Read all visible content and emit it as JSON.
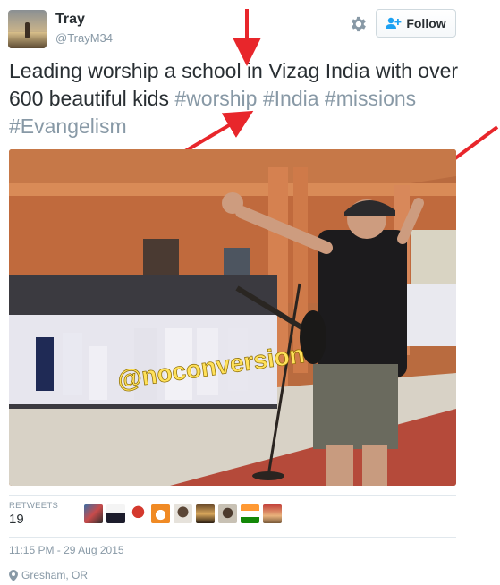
{
  "user": {
    "name": "Tray",
    "handle": "@TrayM34"
  },
  "actions": {
    "follow_label": "Follow",
    "settings_icon": "gear-icon",
    "follow_icon": "person-plus-icon",
    "accent": "#1da1f2"
  },
  "tweet": {
    "text_plain": "Leading worship a school in Vizag  India with over 600 beautiful kids ",
    "hashtags": [
      "#worship",
      "#India",
      "#missions",
      "#Evangelism"
    ]
  },
  "photo": {
    "watermark": "@noconversion"
  },
  "stats": {
    "retweets_label": "RETWEETS",
    "retweets_count": "19"
  },
  "meta": {
    "timestamp": "11:15 PM - 29 Aug 2015",
    "location": "Gresham, OR",
    "location_icon": "map-pin-icon"
  }
}
